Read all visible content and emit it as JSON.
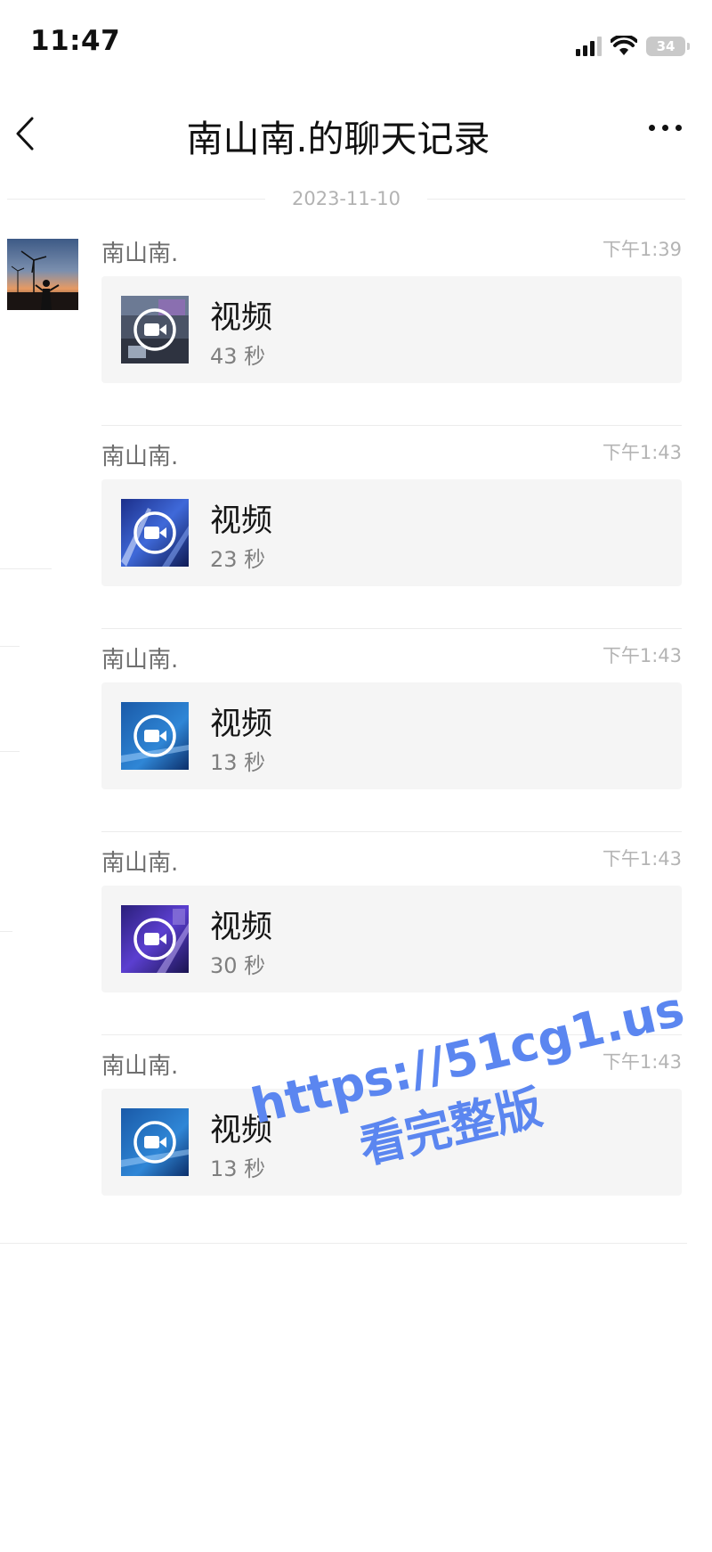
{
  "status_bar": {
    "time": "11:47",
    "battery": "34"
  },
  "nav": {
    "title": "南山南.的聊天记录"
  },
  "date_divider": "2023-11-10",
  "messages": [
    {
      "sender": "南山南.",
      "time": "下午1:39",
      "title": "视频",
      "duration": "43 秒"
    },
    {
      "sender": "南山南.",
      "time": "下午1:43",
      "title": "视频",
      "duration": "23 秒"
    },
    {
      "sender": "南山南.",
      "time": "下午1:43",
      "title": "视频",
      "duration": "13 秒"
    },
    {
      "sender": "南山南.",
      "time": "下午1:43",
      "title": "视频",
      "duration": "30 秒"
    },
    {
      "sender": "南山南.",
      "time": "下午1:43",
      "title": "视频",
      "duration": "13 秒"
    }
  ],
  "watermark": {
    "url": "https://51cg1.us",
    "text": "看完整版"
  },
  "colors": {
    "watermark": "#5b86f0",
    "card_background": "#f5f5f5",
    "secondary_text": "#7f7f7f"
  },
  "icons": [
    "back-chevron-icon",
    "more-dots-icon",
    "video-camera-icon",
    "signal-icon",
    "wifi-icon",
    "battery-icon"
  ]
}
